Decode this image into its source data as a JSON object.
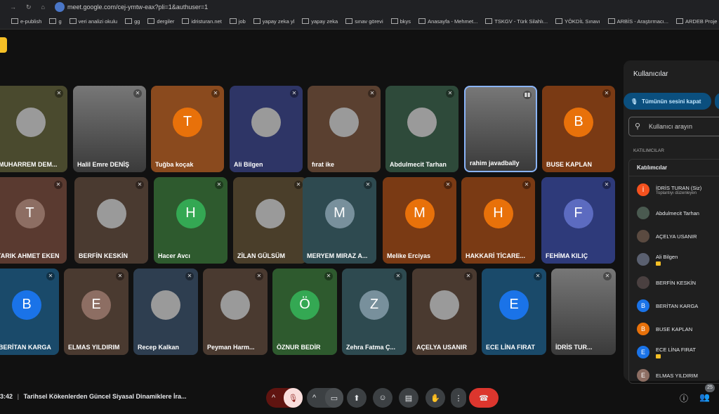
{
  "browser": {
    "url": "meet.google.com/cej-ymtw-eax?pli=1&authuser=1",
    "bookmarks": [
      "e-publish",
      "g",
      "veri analizi okulu",
      "gg",
      "dergiler",
      "idristuran.net",
      "job",
      "yapay zeka yl",
      "yapay zeka",
      "sınav görevi",
      "bkys",
      "Anasayfa - Mehmet...",
      "TSKGV - Türk Silahlı...",
      "YÖKDİL Sınavı",
      "ARBİS - Araştırmacı...",
      "ARDEB Proje Başvur..."
    ]
  },
  "tiles": [
    {
      "name": "MUHARREM DEM...",
      "initial": "",
      "bg": "#4a4a2e",
      "avatar": "photo"
    },
    {
      "name": "Halil Emre DENİŞ",
      "initial": "",
      "bg": "#6b6b6b",
      "avatar": "video"
    },
    {
      "name": "Tuğba koçak",
      "initial": "T",
      "bg": "#8a4a1e",
      "avatar": "#e8710a"
    },
    {
      "name": "Ali Bilgen",
      "initial": "",
      "bg": "#2e3566",
      "avatar": "photo"
    },
    {
      "name": "fırat ike",
      "initial": "",
      "bg": "#5a4030",
      "avatar": "photo"
    },
    {
      "name": "Abdulmecit Tarhan",
      "initial": "",
      "bg": "#2e4a3a",
      "avatar": "photo"
    },
    {
      "name": "rahim javadbally",
      "initial": "",
      "bg": "#555",
      "avatar": "video"
    },
    {
      "name": "BUSE KAPLAN",
      "initial": "B",
      "bg": "#7a3a14",
      "avatar": "#e8710a"
    },
    {
      "name": "TARIK AHMET EKEN",
      "initial": "T",
      "bg": "#5a3a30",
      "avatar": "#8d6e63"
    },
    {
      "name": "BERFİN KESKİN",
      "initial": "",
      "bg": "#4a3a30",
      "avatar": "photo"
    },
    {
      "name": "Hacer Avcı",
      "initial": "H",
      "bg": "#2e5a2e",
      "avatar": "#34a853"
    },
    {
      "name": "ZİLAN GÜLSÜM",
      "initial": "",
      "bg": "#4a3e2a",
      "avatar": "photo"
    },
    {
      "name": "MERYEM MIRAZ A...",
      "initial": "M",
      "bg": "#2e4a50",
      "avatar": "#78909c"
    },
    {
      "name": "Melike Erciyas",
      "initial": "M",
      "bg": "#7a3a14",
      "avatar": "#e8710a"
    },
    {
      "name": "HAKKARİ TİCARE...",
      "initial": "H",
      "bg": "#7a3a14",
      "avatar": "#e8710a"
    },
    {
      "name": "FEHİMA KILIÇ",
      "initial": "F",
      "bg": "#2e3a7a",
      "avatar": "#5c6bc0"
    },
    {
      "name": "BERİTAN KARGA",
      "initial": "B",
      "bg": "#1a4a6a",
      "avatar": "#1a73e8"
    },
    {
      "name": "ELMAS YILDIRIM",
      "initial": "E",
      "bg": "#4a3a30",
      "avatar": "#8d6e63"
    },
    {
      "name": "Recep Kalkan",
      "initial": "",
      "bg": "#2e3e50",
      "avatar": "photo"
    },
    {
      "name": "Peyman Harm...",
      "initial": "",
      "bg": "#4a3a30",
      "avatar": "photo"
    },
    {
      "name": "ÖZNUR BEDİR",
      "initial": "Ö",
      "bg": "#2e5a2e",
      "avatar": "#34a853"
    },
    {
      "name": "Zehra Fatma Ç...",
      "initial": "Z",
      "bg": "#2e4a50",
      "avatar": "#78909c"
    },
    {
      "name": "AÇELYA USANIR",
      "initial": "",
      "bg": "#4a3a30",
      "avatar": "photo"
    },
    {
      "name": "ECE LİNA FIRAT",
      "initial": "E",
      "bg": "#1a4a6a",
      "avatar": "#1a73e8"
    },
    {
      "name": "İDRİS TUR...",
      "initial": "",
      "bg": "#555",
      "avatar": "video"
    }
  ],
  "panel": {
    "title": "Kullanıcılar",
    "mute_all": "Tümünün sesini kapat",
    "search_placeholder": "Kullanıcı arayın",
    "section": "KATILIMCILAR",
    "list_header": "Katılımcılar",
    "participants": [
      {
        "name": "İDRİS TURAN (Siz)",
        "sub": "Toplantıyı düzenleyen",
        "initial": "İ",
        "color": "#f4511e"
      },
      {
        "name": "Abdulmecit Tarhan",
        "initial": "",
        "color": "#4a5a50"
      },
      {
        "name": "AÇELYA USANIR",
        "initial": "",
        "color": "#5a4a40"
      },
      {
        "name": "Ali Bilgen",
        "initial": "",
        "color": "#5a6070",
        "badge": true
      },
      {
        "name": "BERFİN KESKİN",
        "initial": "",
        "color": "#4a4040"
      },
      {
        "name": "BERİTAN KARGA",
        "initial": "B",
        "color": "#1a73e8"
      },
      {
        "name": "BUSE KAPLAN",
        "initial": "B",
        "color": "#e8710a"
      },
      {
        "name": "ECE LİNA FIRAT",
        "initial": "E",
        "color": "#1a73e8",
        "badge": true
      },
      {
        "name": "ELMAS YILDIRIM",
        "initial": "E",
        "color": "#8d6e63"
      }
    ]
  },
  "bottom": {
    "time": "3:42",
    "meeting_title": "Tarihsel Kökenlerden Güncel Siyasal Dinamiklere İra...",
    "participant_count": "25"
  }
}
